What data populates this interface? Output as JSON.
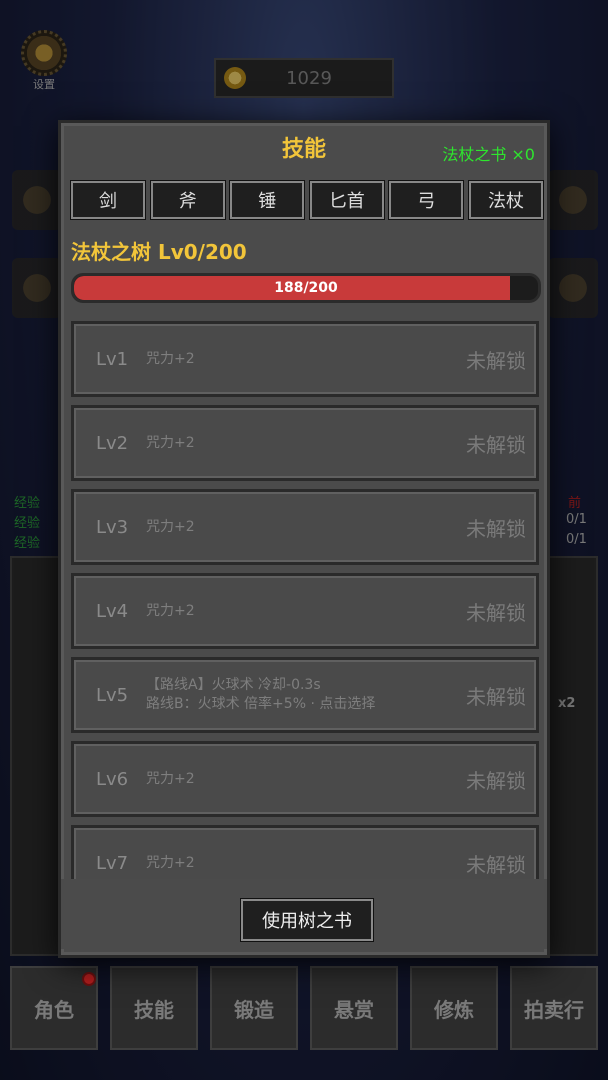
{
  "background": {
    "settings_label": "设置",
    "gold": "1029",
    "left_labels": [
      "经验",
      "经验",
      "经验"
    ],
    "right_red_label": "前",
    "right_ratios": [
      "0/1",
      "0/1"
    ],
    "multiplier": "x2"
  },
  "dialog": {
    "title": "技能",
    "book_count": "法杖之书 ×0",
    "tabs": [
      "剑",
      "斧",
      "锤",
      "匕首",
      "弓",
      "法杖"
    ],
    "tree_title": "法杖之树  Lv0/200",
    "progress": {
      "current": 188,
      "max": 200,
      "text": "188/200"
    },
    "levels": [
      {
        "lv": "Lv1",
        "line1": "咒力+2",
        "line2": "",
        "status": "未解锁"
      },
      {
        "lv": "Lv2",
        "line1": "咒力+2",
        "line2": "",
        "status": "未解锁"
      },
      {
        "lv": "Lv3",
        "line1": "咒力+2",
        "line2": "",
        "status": "未解锁"
      },
      {
        "lv": "Lv4",
        "line1": "咒力+2",
        "line2": "",
        "status": "未解锁"
      },
      {
        "lv": "Lv5",
        "line1": "【路线A】火球术 冷却-0.3s",
        "line2": "路线B：火球术 倍率+5% · 点击选择",
        "status": "未解锁"
      },
      {
        "lv": "Lv6",
        "line1": "咒力+2",
        "line2": "",
        "status": "未解锁"
      },
      {
        "lv": "Lv7",
        "line1": "咒力+2",
        "line2": "",
        "status": "未解锁"
      }
    ],
    "use_button": "使用树之书"
  },
  "bottom_nav": [
    "角色",
    "技能",
    "锻造",
    "悬赏",
    "修炼",
    "拍卖行"
  ],
  "colors": {
    "accent_gold": "#f2c53a",
    "book_green": "#2ee52e",
    "progress_red": "#c83a3a"
  }
}
